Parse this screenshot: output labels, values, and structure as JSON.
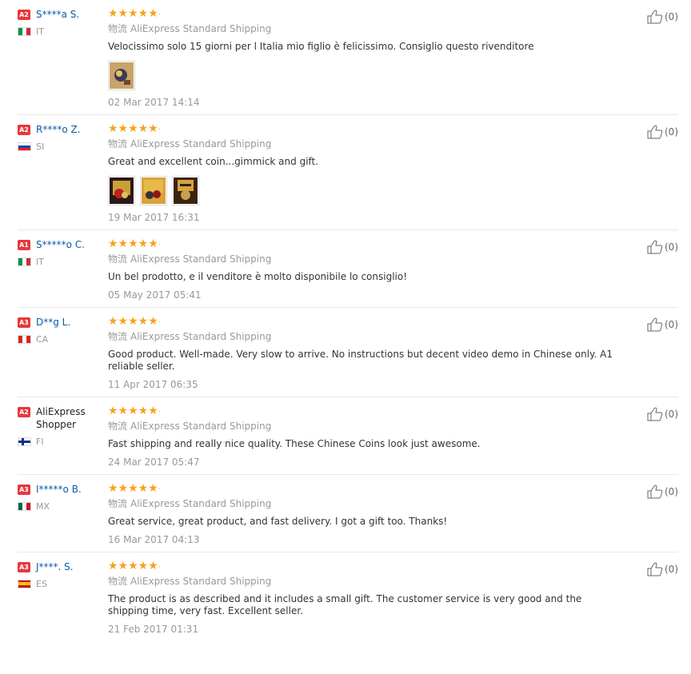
{
  "helpful_icon": "thumbs-up-icon",
  "colors": {
    "star": "#f7a21b",
    "username": "#0b5ba8",
    "badge": "#e4393c"
  },
  "reviews": [
    {
      "badge": "A2",
      "name": "S****a S.",
      "country": "IT",
      "rating": 5,
      "shipping_cn": "物流",
      "shipping": "AliExpress Standard Shipping",
      "text": "Velocissimo solo 15 giorni per l Italia mio figlio è felicissimo. Consiglio questo rivenditore",
      "photos": 1,
      "date": "02 Mar 2017 14:14",
      "helpful": "(0)"
    },
    {
      "badge": "A2",
      "name": "R****o Z.",
      "country": "SI",
      "rating": 5,
      "shipping_cn": "物流",
      "shipping": "AliExpress Standard Shipping",
      "text": "Great and excellent coin...gimmick and gift.",
      "photos": 3,
      "date": "19 Mar 2017 16:31",
      "helpful": "(0)"
    },
    {
      "badge": "A1",
      "name": "S*****o C.",
      "country": "IT",
      "rating": 5,
      "shipping_cn": "物流",
      "shipping": "AliExpress Standard Shipping",
      "text": "Un bel prodotto, e il venditore è molto disponibile lo consiglio!",
      "photos": 0,
      "date": "05 May 2017 05:41",
      "helpful": "(0)"
    },
    {
      "badge": "A3",
      "name": "D**g L.",
      "country": "CA",
      "rating": 5,
      "shipping_cn": "物流",
      "shipping": "AliExpress Standard Shipping",
      "text": "Good product. Well-made. Very slow to arrive. No instructions but decent video demo in Chinese only. A1 reliable seller.",
      "photos": 0,
      "date": "11 Apr 2017 06:35",
      "helpful": "(0)"
    },
    {
      "badge": "A2",
      "name": "AliExpress Shopper",
      "country": "FI",
      "rating": 5,
      "shipping_cn": "物流",
      "shipping": "AliExpress Standard Shipping",
      "text": "Fast shipping and really nice quality. These Chinese Coins look just awesome.",
      "photos": 0,
      "date": "24 Mar 2017 05:47",
      "helpful": "(0)"
    },
    {
      "badge": "A3",
      "name": "I*****o B.",
      "country": "MX",
      "rating": 5,
      "shipping_cn": "物流",
      "shipping": "AliExpress Standard Shipping",
      "text": "Great service, great product, and fast delivery. I got a gift too. Thanks!",
      "photos": 0,
      "date": "16 Mar 2017 04:13",
      "helpful": "(0)"
    },
    {
      "badge": "A3",
      "name": "J****. S.",
      "country": "ES",
      "rating": 5,
      "shipping_cn": "物流",
      "shipping": "AliExpress Standard Shipping",
      "text": "The product is as described and it includes a small gift. The customer service is very good and the shipping time, very fast. Excellent seller.",
      "photos": 0,
      "date": "21 Feb 2017 01:31",
      "helpful": "(0)"
    }
  ]
}
